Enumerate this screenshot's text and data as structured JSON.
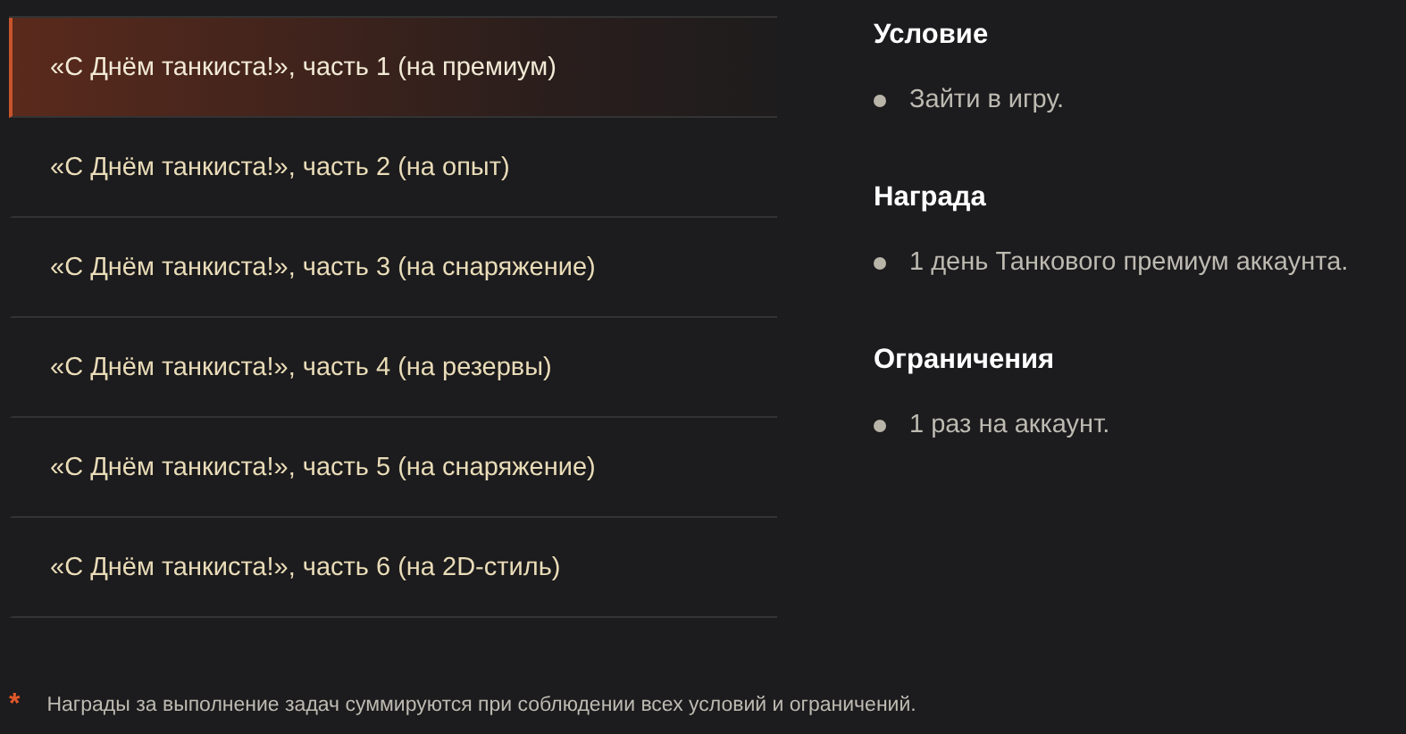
{
  "tasks": [
    {
      "label": "«С Днём танкиста!», часть 1 (на премиум)",
      "selected": true
    },
    {
      "label": "«С Днём танкиста!», часть 2 (на опыт)",
      "selected": false
    },
    {
      "label": "«С Днём танкиста!», часть 3 (на снаряжение)",
      "selected": false
    },
    {
      "label": "«С Днём танкиста!», часть 4 (на резервы)",
      "selected": false
    },
    {
      "label": "«С Днём танкиста!», часть 5 (на снаряжение)",
      "selected": false
    },
    {
      "label": "«С Днём танкиста!», часть 6 (на 2D-стиль)",
      "selected": false
    }
  ],
  "sections": [
    {
      "heading": "Условие",
      "items": [
        "Зайти в игру."
      ]
    },
    {
      "heading": "Награда",
      "items": [
        "1 день Танкового премиум аккаунта."
      ]
    },
    {
      "heading": "Ограничения",
      "items": [
        "1 раз на аккаунт."
      ]
    }
  ],
  "footnote": {
    "mark": "*",
    "text": "Награды за выполнение задач суммируются при соблюдении всех условий и ограничений."
  }
}
